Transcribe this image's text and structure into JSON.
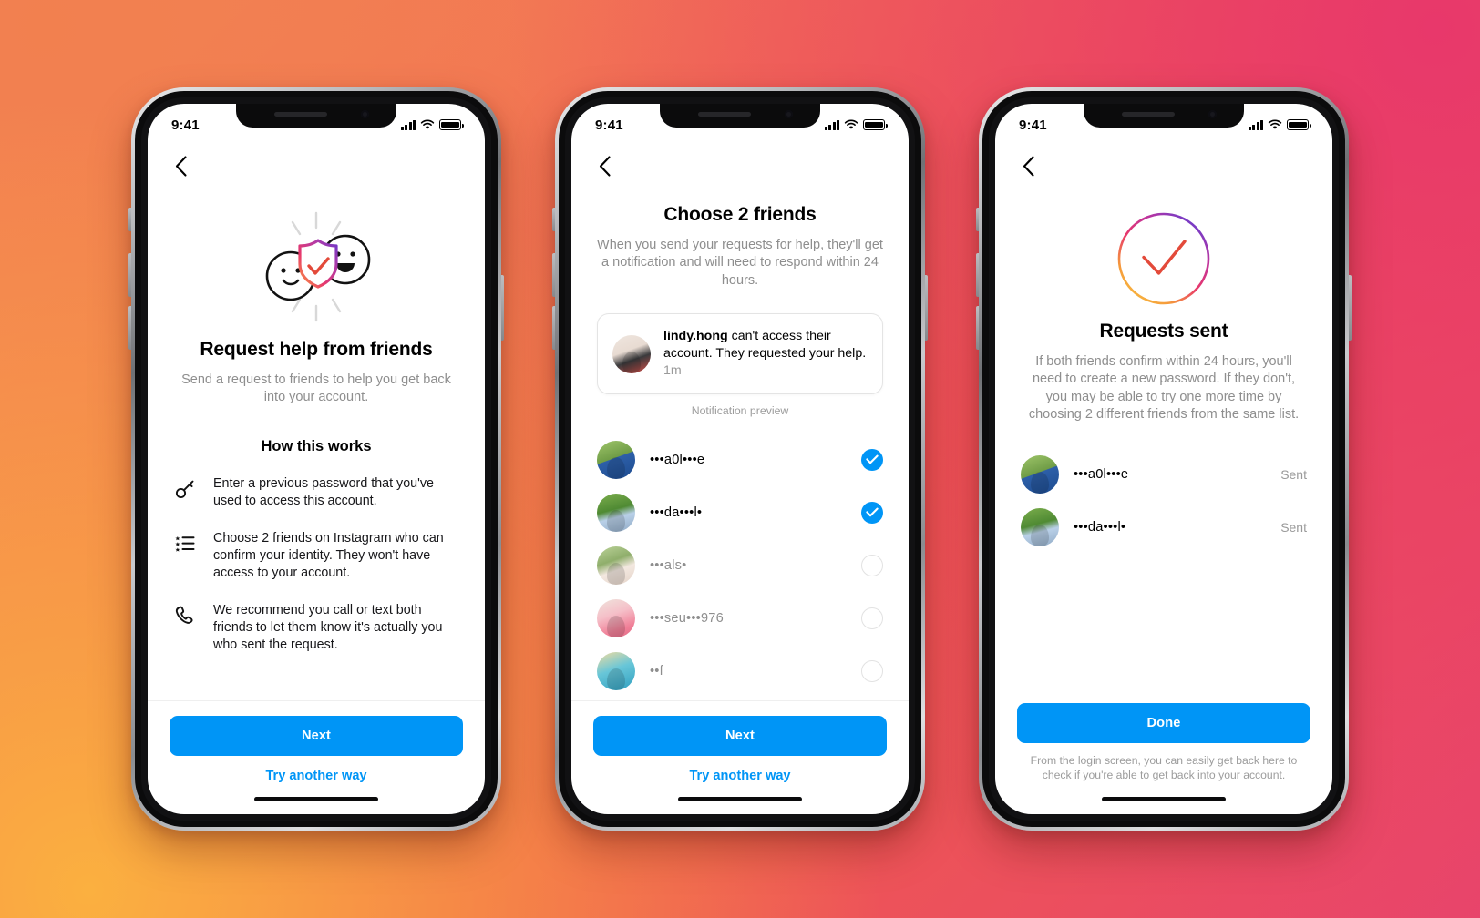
{
  "background": {
    "colors": [
      "#F2804F",
      "#E8386B",
      "#FBB040",
      "#F05B4E"
    ]
  },
  "accent": {
    "blue": "#0095F6",
    "muted_gray": "#8e8e8e"
  },
  "status_bar": {
    "time": "9:41",
    "signal_icon": "cellular-bars-icon",
    "wifi_icon": "wifi-icon",
    "battery_icon": "battery-full-icon"
  },
  "phones": [
    {
      "id": "screen-request-help",
      "back_icon": "chevron-left-icon",
      "illustration": "friends-shield-check-illustration",
      "title": "Request help from friends",
      "subtitle": "Send a request to friends to help you get back into your account.",
      "section_title": "How this works",
      "steps": [
        {
          "icon": "key-icon",
          "text": "Enter a previous password that you've used to access this account."
        },
        {
          "icon": "checklist-icon",
          "text": "Choose 2 friends on Instagram who can confirm your identity. They won't have access to your account."
        },
        {
          "icon": "phone-call-icon",
          "text": "We recommend you call or text both friends to let them know it's actually you who sent the request."
        }
      ],
      "primary_button": "Next",
      "secondary_link": "Try another way"
    },
    {
      "id": "screen-choose-friends",
      "back_icon": "chevron-left-icon",
      "title": "Choose 2 friends",
      "subtitle": "When you send your requests for help, they'll get a notification and will need to respond within 24 hours.",
      "notification": {
        "avatar": "lindy-hong-avatar",
        "username": "lindy.hong",
        "body": " can't access their account. They requested your help.",
        "timestamp": "1m",
        "caption": "Notification preview"
      },
      "friends": [
        {
          "avatar": "friend-avatar-1",
          "name": "•••a0l•••e",
          "selected": true,
          "style": "av-a"
        },
        {
          "avatar": "friend-avatar-2",
          "name": "•••da•••l•",
          "selected": true,
          "style": "av-b"
        },
        {
          "avatar": "friend-avatar-3",
          "name": "•••als•",
          "selected": false,
          "style": "av-c"
        },
        {
          "avatar": "friend-avatar-4",
          "name": "•••seu•••976",
          "selected": false,
          "style": "av-d"
        },
        {
          "avatar": "friend-avatar-5",
          "name": "••f",
          "selected": false,
          "style": "av-e"
        }
      ],
      "primary_button": "Next",
      "secondary_link": "Try another way"
    },
    {
      "id": "screen-requests-sent",
      "back_icon": "chevron-left-icon",
      "illustration": "gradient-circle-check-icon",
      "title": "Requests sent",
      "subtitle": "If both friends confirm within 24 hours, you'll need to create a new password. If they don't, you may be able to try one more time by choosing 2 different friends from the same list.",
      "sent_list": [
        {
          "avatar": "friend-avatar-1",
          "name": "•••a0l•••e",
          "status": "Sent",
          "style": "av-a"
        },
        {
          "avatar": "friend-avatar-2",
          "name": "•••da•••l•",
          "status": "Sent",
          "style": "av-b"
        }
      ],
      "primary_button": "Done",
      "fineprint": "From the login screen, you can easily get back here to check if you're able to get back into your account."
    }
  ]
}
